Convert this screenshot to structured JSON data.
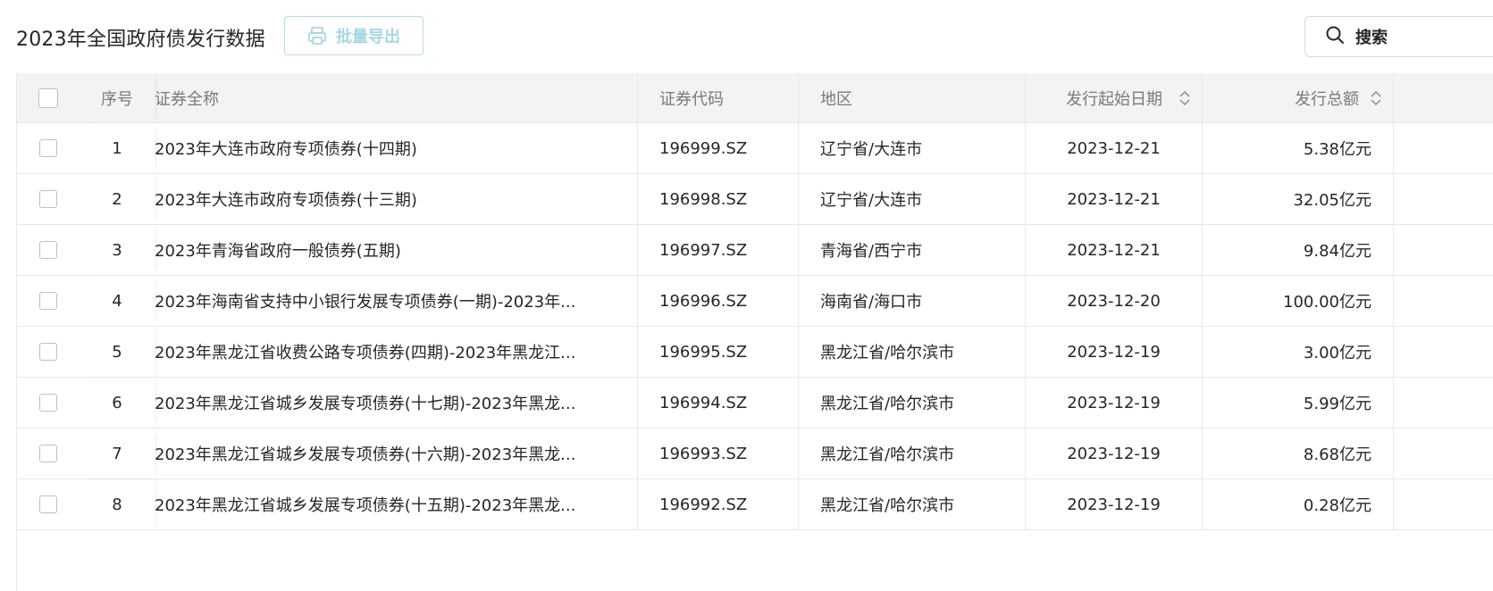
{
  "header": {
    "title": "2023年全国政府债发行数据",
    "export_label": "批量导出",
    "search_label": "搜索"
  },
  "table": {
    "columns": {
      "index": "序号",
      "name": "证券全称",
      "code": "证券代码",
      "region": "地区",
      "start_date": "发行起始日期",
      "amount": "发行总额"
    },
    "rows": [
      {
        "index": "1",
        "name": "2023年大连市政府专项债券(十四期)",
        "code": "196999.SZ",
        "region": "辽宁省/大连市",
        "start_date": "2023-12-21",
        "amount": "5.38亿元"
      },
      {
        "index": "2",
        "name": "2023年大连市政府专项债券(十三期)",
        "code": "196998.SZ",
        "region": "辽宁省/大连市",
        "start_date": "2023-12-21",
        "amount": "32.05亿元"
      },
      {
        "index": "3",
        "name": "2023年青海省政府一般债券(五期)",
        "code": "196997.SZ",
        "region": "青海省/西宁市",
        "start_date": "2023-12-21",
        "amount": "9.84亿元"
      },
      {
        "index": "4",
        "name": "2023年海南省支持中小银行发展专项债券(一期)-2023年...",
        "code": "196996.SZ",
        "region": "海南省/海口市",
        "start_date": "2023-12-20",
        "amount": "100.00亿元"
      },
      {
        "index": "5",
        "name": "2023年黑龙江省收费公路专项债券(四期)-2023年黑龙江...",
        "code": "196995.SZ",
        "region": "黑龙江省/哈尔滨市",
        "start_date": "2023-12-19",
        "amount": "3.00亿元"
      },
      {
        "index": "6",
        "name": "2023年黑龙江省城乡发展专项债券(十七期)-2023年黑龙...",
        "code": "196994.SZ",
        "region": "黑龙江省/哈尔滨市",
        "start_date": "2023-12-19",
        "amount": "5.99亿元"
      },
      {
        "index": "7",
        "name": "2023年黑龙江省城乡发展专项债券(十六期)-2023年黑龙...",
        "code": "196993.SZ",
        "region": "黑龙江省/哈尔滨市",
        "start_date": "2023-12-19",
        "amount": "8.68亿元"
      },
      {
        "index": "8",
        "name": "2023年黑龙江省城乡发展专项债券(十五期)-2023年黑龙...",
        "code": "196992.SZ",
        "region": "黑龙江省/哈尔滨市",
        "start_date": "2023-12-19",
        "amount": "0.28亿元"
      }
    ]
  }
}
